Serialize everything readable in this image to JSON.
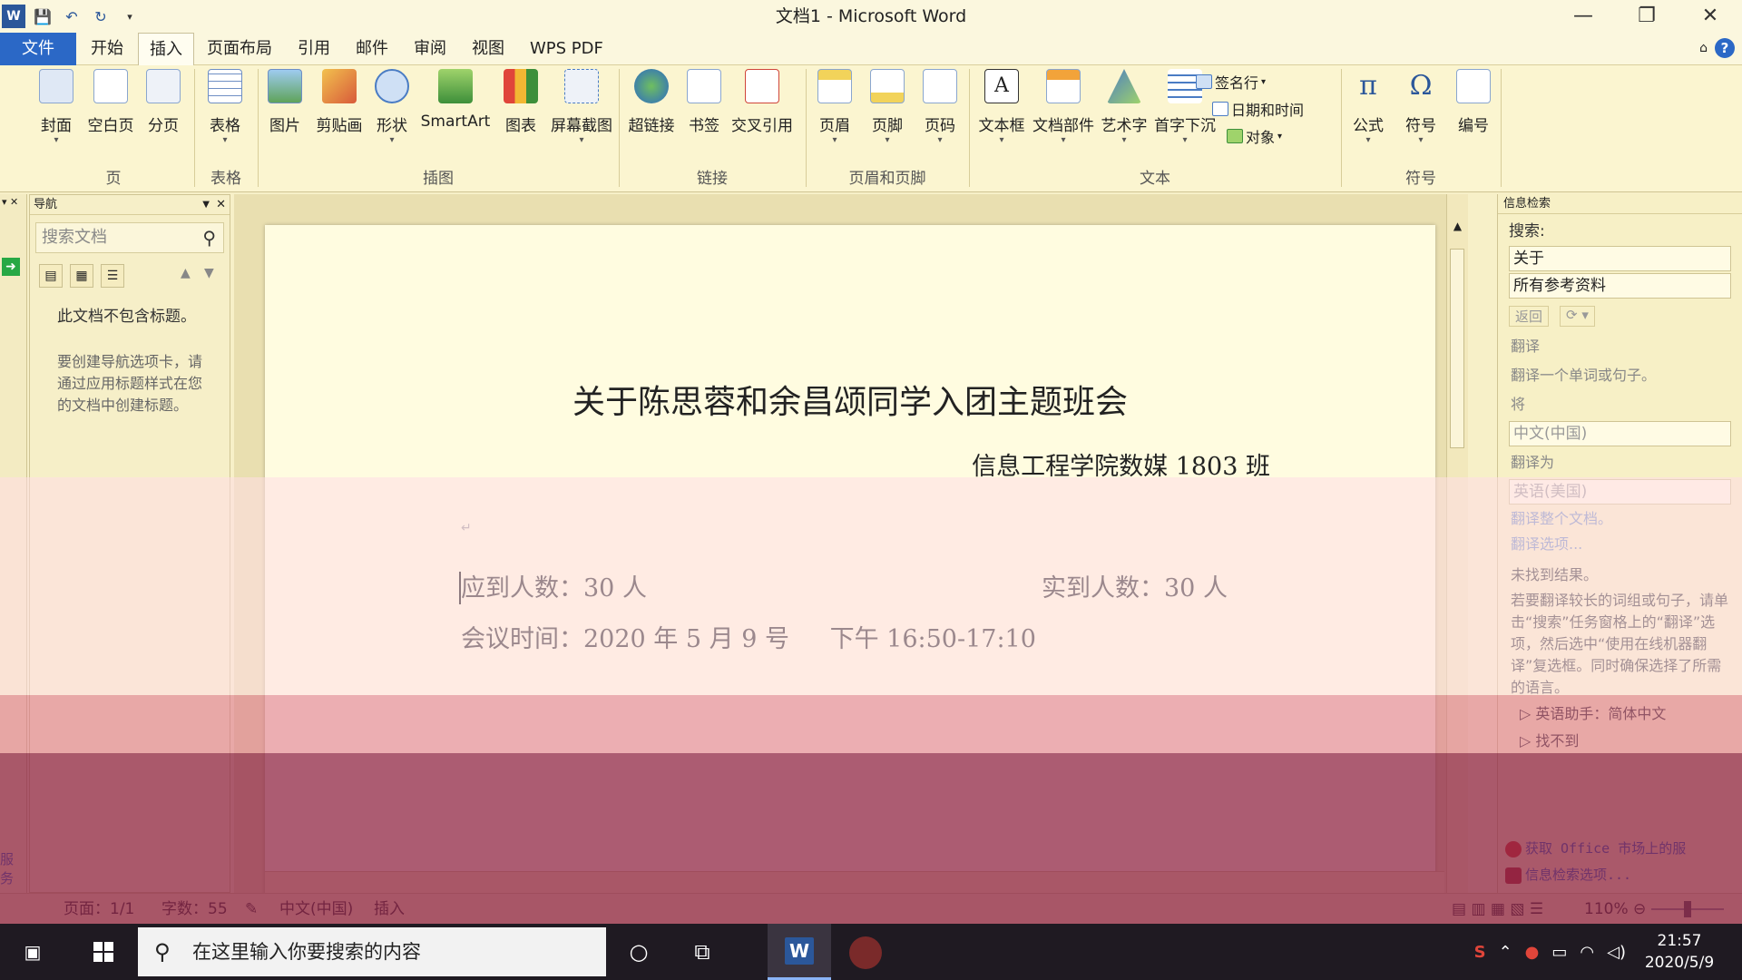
{
  "window": {
    "title": "文档1 - Microsoft Word",
    "controls": [
      "—",
      "❐",
      "✕"
    ]
  },
  "quick_access": [
    "save-icon",
    "undo-icon",
    "redo-icon",
    "customize-icon"
  ],
  "tabs": {
    "file": "文件",
    "items": [
      "开始",
      "插入",
      "页面布局",
      "引用",
      "邮件",
      "审阅",
      "视图",
      "WPS PDF"
    ],
    "active": "插入"
  },
  "ribbon": {
    "groups": [
      {
        "label": "页",
        "buttons": [
          "封面",
          "空白页",
          "分页"
        ]
      },
      {
        "label": "表格",
        "buttons": [
          "表格"
        ]
      },
      {
        "label": "插图",
        "buttons": [
          "图片",
          "剪贴画",
          "形状",
          "SmartArt",
          "图表",
          "屏幕截图"
        ]
      },
      {
        "label": "链接",
        "buttons": [
          "超链接",
          "书签",
          "交叉引用"
        ]
      },
      {
        "label": "页眉和页脚",
        "buttons": [
          "页眉",
          "页脚",
          "页码"
        ]
      },
      {
        "label": "文本",
        "buttons": [
          "文本框",
          "文档部件",
          "艺术字",
          "首字下沉"
        ],
        "small": [
          "签名行",
          "日期和时间",
          "对象"
        ]
      },
      {
        "label": "符号",
        "buttons": [
          "公式",
          "符号",
          "编号"
        ]
      }
    ]
  },
  "nav_pane": {
    "title": "导航",
    "search_placeholder": "搜索文档",
    "message": "此文档不包含标题。",
    "hint": "要创建导航选项卡，请通过应用标题样式在您的文档中创建标题。",
    "left_service": "服务"
  },
  "document": {
    "title": "关于陈思蓉和余昌颂同学入团主题班会",
    "subtitle": "信息工程学院数媒 1803 班",
    "expected_label": "应到人数：30 人",
    "actual_label": "实到人数：30 人",
    "meeting_time": "会议时间：2020 年 5 月 9 号",
    "meeting_period": "下午 16:50-17:10"
  },
  "research_pane": {
    "title": "信息检索",
    "search_label": "搜索:",
    "search_value": "关于",
    "source": "所有参考资料",
    "back": "返回",
    "forward": "",
    "section_translate": "翻译",
    "translate_hint": "翻译一个单词或句子。",
    "from_label": "将",
    "from_lang": "中文(中国)",
    "to_label": "翻译为",
    "to_lang": "英语(美国)",
    "translate_doc": "翻译整个文档。",
    "translate_options": "翻译选项...",
    "no_results": "未找到结果。",
    "advice": "若要翻译较长的词组或句子，请单击“搜索”任务窗格上的“翻译”选项，然后选中“使用在线机器翻译”复选框。同时确保选择了所需的语言。",
    "tree1": "英语助手：简体中文",
    "tree2": "找不到",
    "foot1": "获取 Office 市场上的服",
    "foot2": "信息检索选项..."
  },
  "status": {
    "page": "页面：1/1",
    "words": "字数：55",
    "language": "中文(中国)",
    "mode": "插入",
    "zoom": "110%"
  },
  "taskbar": {
    "search_placeholder": "在这里输入你要搜索的内容",
    "time": "21:57",
    "date": "2020/5/9"
  },
  "colors": {
    "accent": "#2b68c6",
    "ribbon": "#fbf5d0",
    "page": "#fffce0",
    "taskbar": "#1f1a22"
  }
}
